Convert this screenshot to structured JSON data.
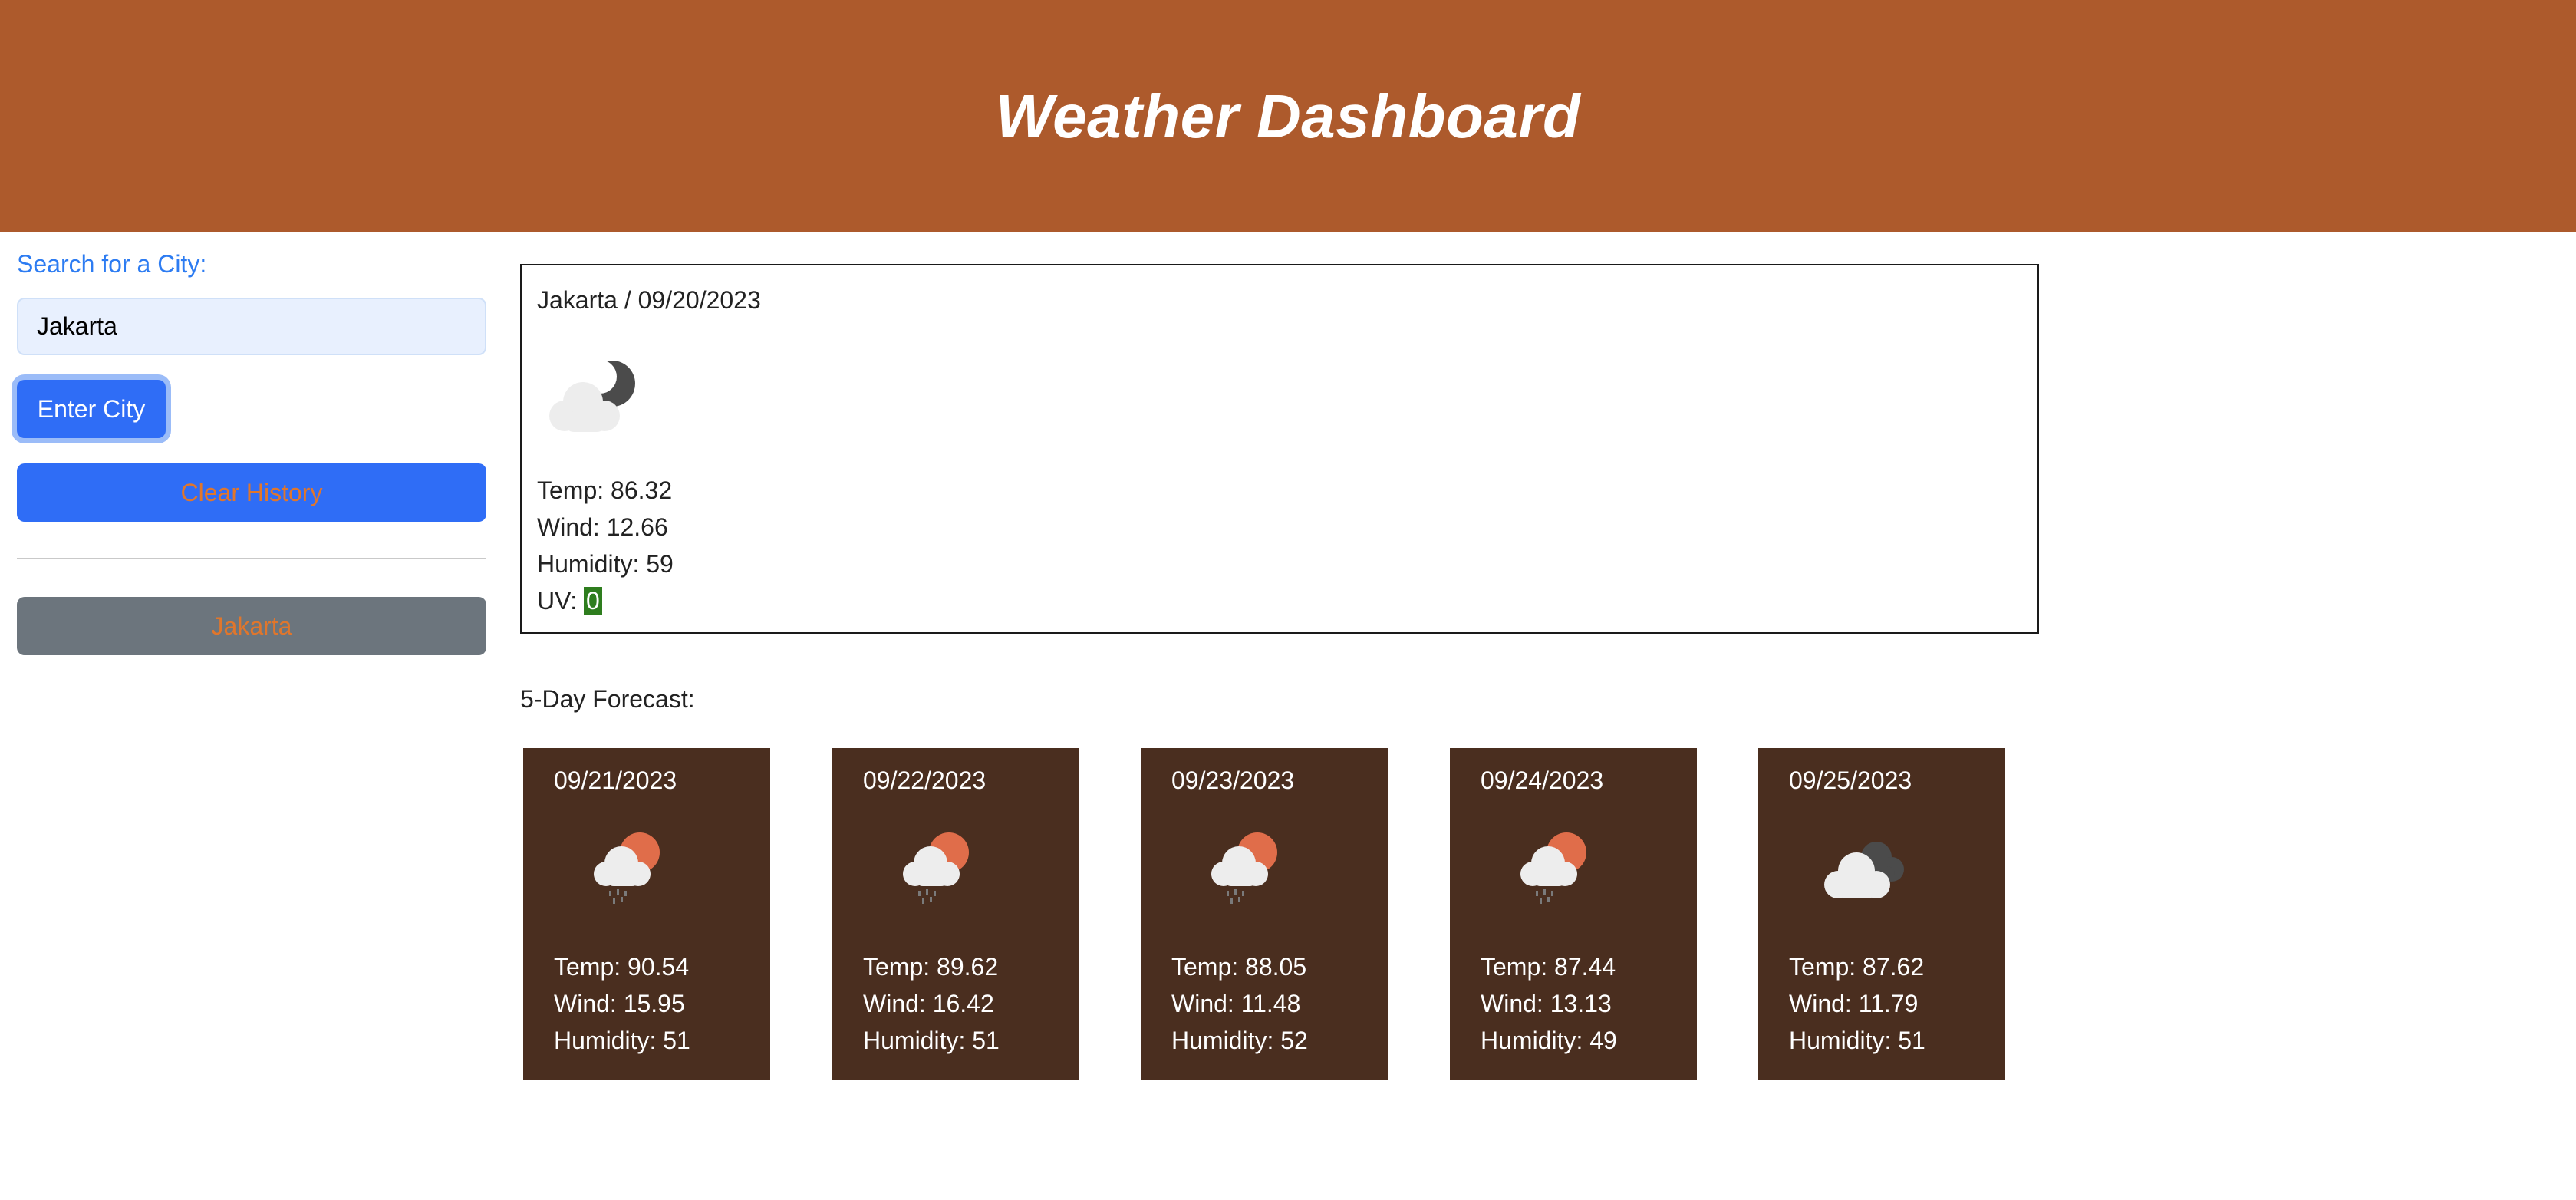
{
  "header": {
    "title": "Weather Dashboard"
  },
  "sidebar": {
    "search_label": "Search for a City:",
    "search_value": "Jakarta",
    "enter_button": "Enter City",
    "clear_button": "Clear History",
    "history": [
      "Jakarta"
    ]
  },
  "current": {
    "title": "Jakarta / 09/20/2023",
    "icon": "cloud-moon-icon",
    "temp": "Temp: 86.32",
    "wind": "Wind: 12.66",
    "humidity": "Humidity: 59",
    "uv_label": "UV: ",
    "uv_value": "0",
    "uv_color": "#2e7d1e"
  },
  "forecast": {
    "title": "5-Day Forecast:",
    "days": [
      {
        "date": "09/21/2023",
        "icon": "rain-sun-icon",
        "temp": "Temp: 90.54",
        "wind": "Wind: 15.95",
        "humidity": "Humidity: 51"
      },
      {
        "date": "09/22/2023",
        "icon": "rain-sun-icon",
        "temp": "Temp: 89.62",
        "wind": "Wind: 16.42",
        "humidity": "Humidity: 51"
      },
      {
        "date": "09/23/2023",
        "icon": "rain-sun-icon",
        "temp": "Temp: 88.05",
        "wind": "Wind: 11.48",
        "humidity": "Humidity: 52"
      },
      {
        "date": "09/24/2023",
        "icon": "rain-sun-icon",
        "temp": "Temp: 87.44",
        "wind": "Wind: 13.13",
        "humidity": "Humidity: 49"
      },
      {
        "date": "09/25/2023",
        "icon": "broken-clouds-icon",
        "temp": "Temp: 87.62",
        "wind": "Wind: 11.79",
        "humidity": "Humidity: 51"
      }
    ]
  },
  "colors": {
    "header_bg": "#ad5a2c",
    "primary_button": "#2f6df6",
    "history_button": "#6c757d",
    "button_text_orange": "#e0762c",
    "card_bg": "#4a2e1f"
  }
}
